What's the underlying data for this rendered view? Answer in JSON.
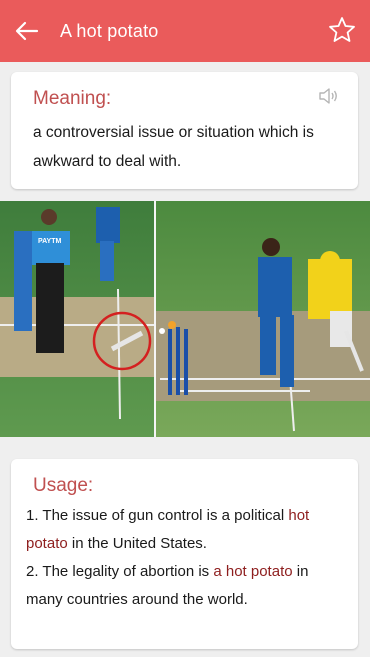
{
  "appbar": {
    "title": "A hot potato",
    "back_icon": "arrow-left-icon",
    "star_icon": "star-outline-icon",
    "bg_color": "#ea5b5b"
  },
  "meaning": {
    "heading": "Meaning:",
    "text": "a controversial issue or situation which is awkward to deal with.",
    "speaker_icon": "speaker-icon"
  },
  "image": {
    "umpire_shirt_text": "PAYTM"
  },
  "usage": {
    "heading": "Usage:",
    "ex1_pre": "1. The issue of gun control is a political ",
    "ex1_hl": "hot potato",
    "ex1_post": " in the United States.",
    "ex2_pre": "2. The legality of abortion is ",
    "ex2_hl": "a hot potato",
    "ex2_post": " in many countries around the world."
  }
}
